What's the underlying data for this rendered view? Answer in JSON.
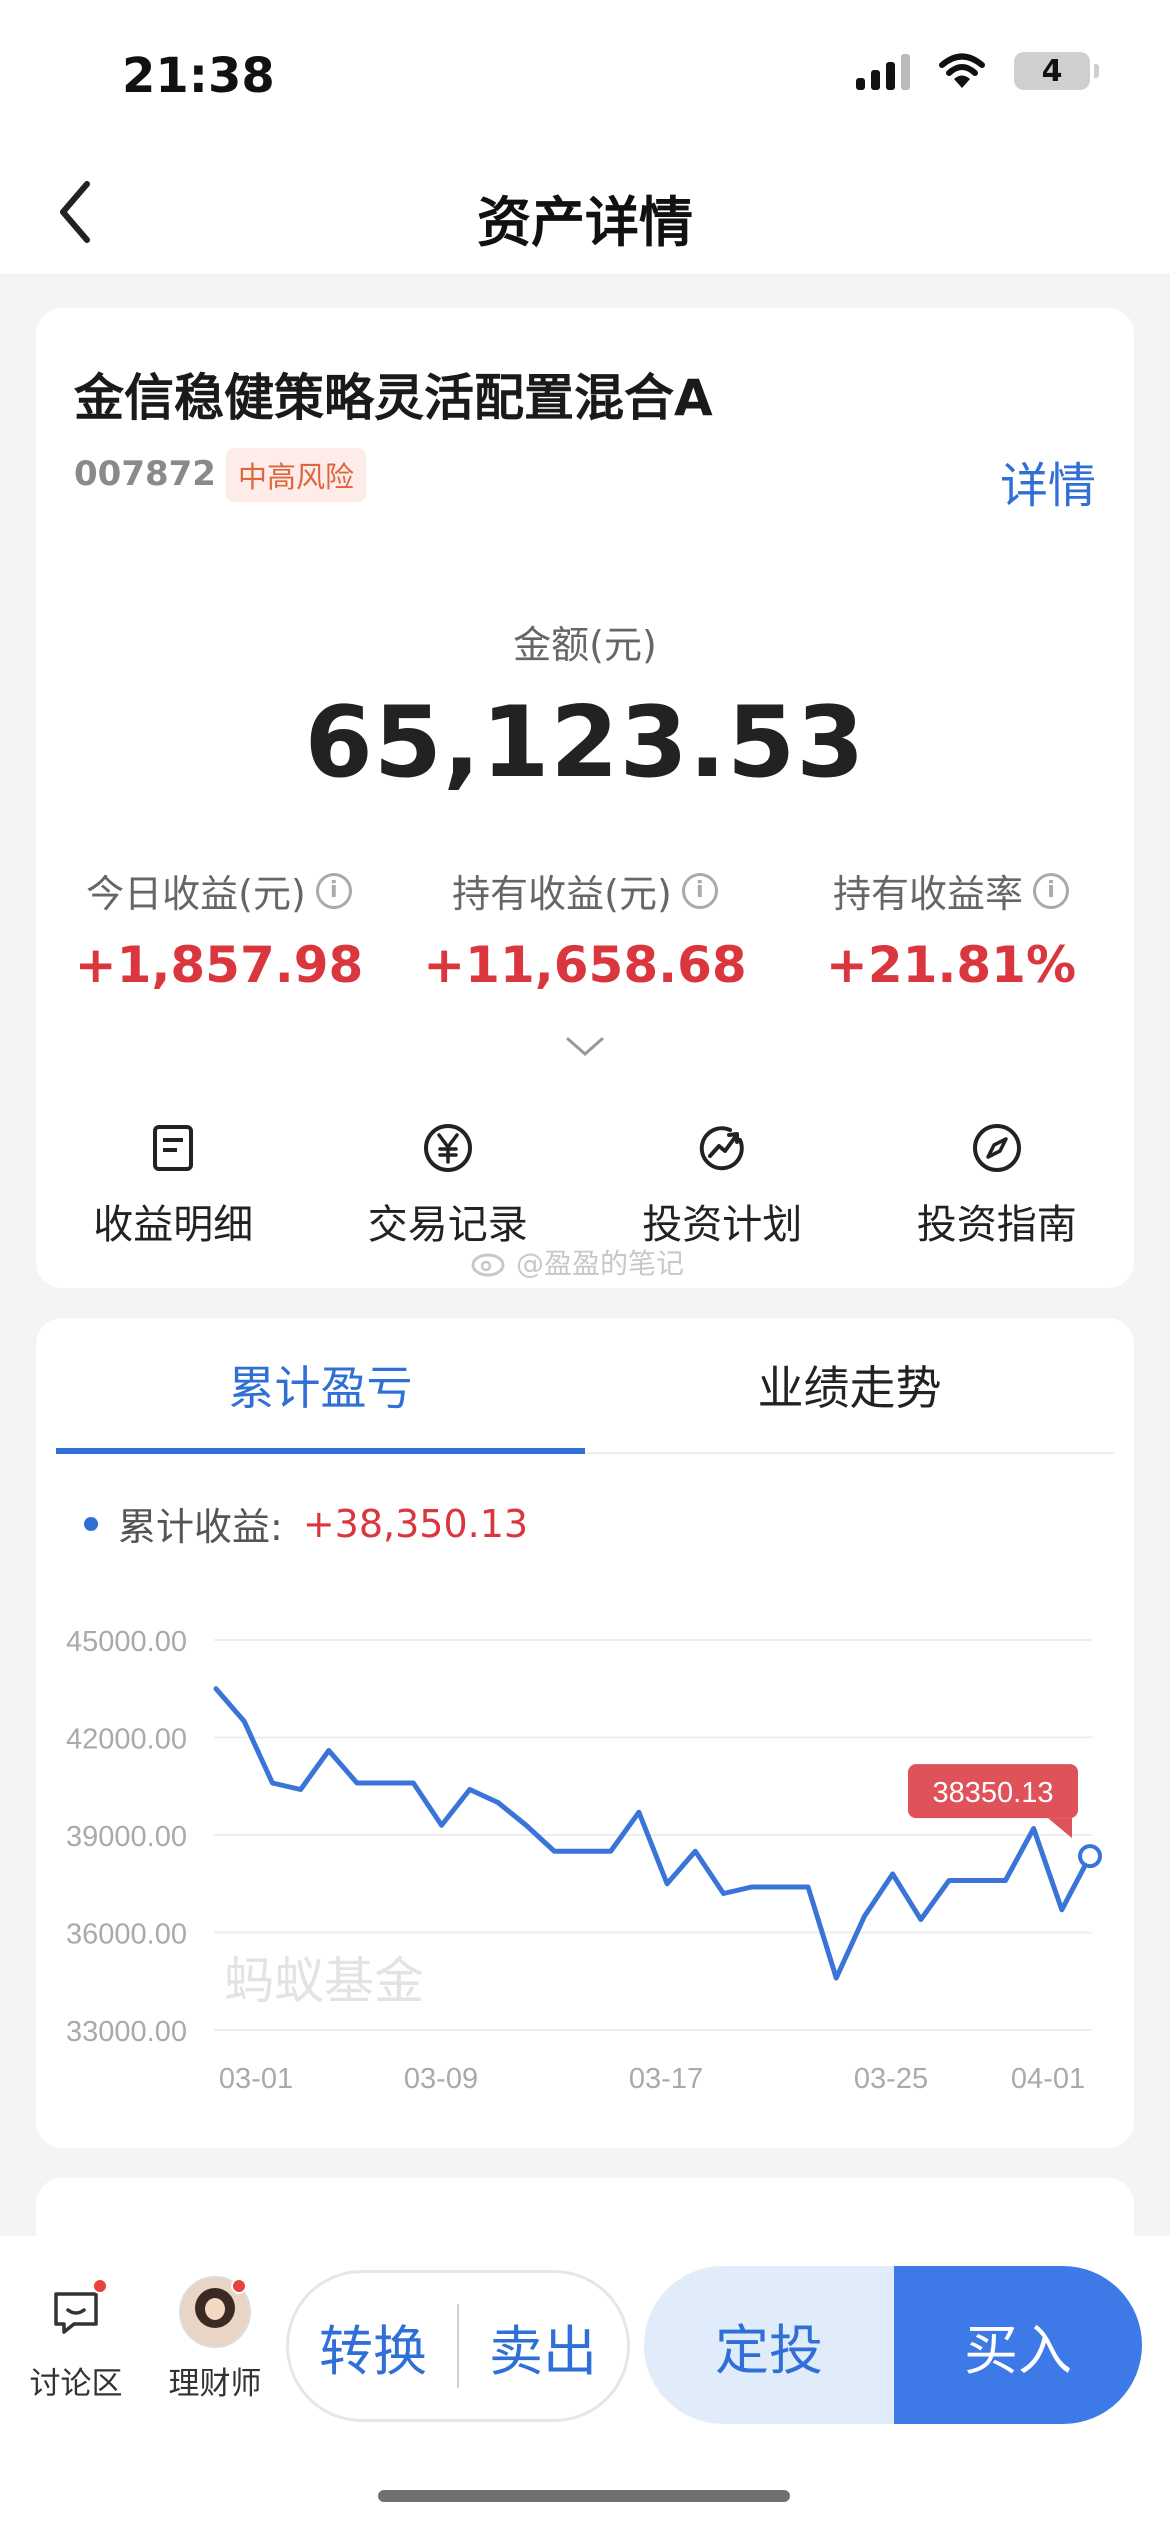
{
  "status": {
    "time": "21:38",
    "battery": "4"
  },
  "nav": {
    "title": "资产详情"
  },
  "fund": {
    "name": "金信稳健策略灵活配置混合A",
    "code": "007872",
    "risk": "中高风险",
    "detail_link": "详情"
  },
  "amount": {
    "label": "金额(元)",
    "value": "65,123.53"
  },
  "stats": [
    {
      "label": "今日收益(元)",
      "value": "+1,857.98"
    },
    {
      "label": "持有收益(元)",
      "value": "+11,658.68"
    },
    {
      "label": "持有收益率",
      "value": "+21.81%"
    }
  ],
  "actions": [
    {
      "label": "收益明细",
      "icon": "document-icon"
    },
    {
      "label": "交易记录",
      "icon": "yen-icon"
    },
    {
      "label": "投资计划",
      "icon": "trend-icon"
    },
    {
      "label": "投资指南",
      "icon": "compass-icon"
    }
  ],
  "watermark": "@盈盈的笔记",
  "tabs": [
    {
      "label": "累计盈亏",
      "active": true
    },
    {
      "label": "业绩走势",
      "active": false
    }
  ],
  "legend": {
    "label": "累计收益:",
    "value": "+38,350.13"
  },
  "chart_watermark": "蚂蚁基金",
  "chart_data": {
    "type": "line",
    "series": [
      {
        "name": "累计收益",
        "color": "#3a74d8",
        "values": [
          43500,
          42500,
          40600,
          40400,
          41600,
          40600,
          40600,
          40600,
          39300,
          40400,
          40000,
          39300,
          38500,
          38500,
          38500,
          39700,
          37500,
          38500,
          37200,
          37400,
          37400,
          37400,
          34600,
          36500,
          37800,
          36400,
          37600,
          37600,
          37600,
          39200,
          36700,
          38350.13
        ]
      }
    ],
    "ylim": [
      33000,
      45000
    ],
    "yticks": [
      "45000.00",
      "42000.00",
      "39000.00",
      "36000.00",
      "33000.00"
    ],
    "xticks": [
      "03-01",
      "03-09",
      "03-17",
      "03-25",
      "04-01"
    ],
    "tooltip": "38350.13",
    "grid": true
  },
  "bottom": {
    "tools": [
      {
        "label": "讨论区"
      },
      {
        "label": "理财师"
      }
    ],
    "convert": "转换",
    "sell": "卖出",
    "auto_invest": "定投",
    "buy": "买入"
  },
  "colors": {
    "accent": "#2f6fd6",
    "gain": "#d9363e",
    "buy": "#3d7ae8"
  }
}
